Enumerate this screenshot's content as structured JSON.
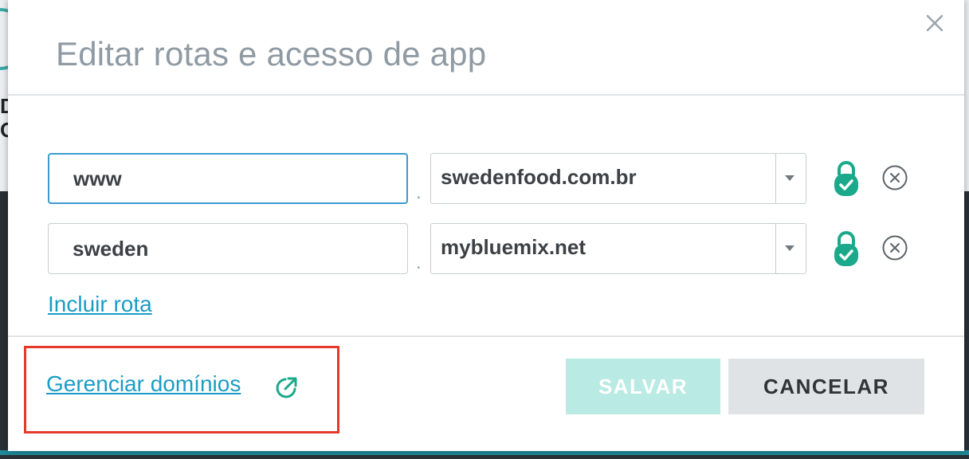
{
  "dialog": {
    "title": "Editar rotas e acesso de app",
    "close_icon": "close-icon"
  },
  "routes": [
    {
      "host": "www",
      "domain": "swedenfood.com.br",
      "separator": ".",
      "secure_icon": "lock-check-icon",
      "remove_icon": "remove-circle-icon",
      "focused": true
    },
    {
      "host": "sweden",
      "domain": "mybluemix.net",
      "separator": ".",
      "secure_icon": "lock-check-icon",
      "remove_icon": "remove-circle-icon",
      "focused": false
    }
  ],
  "actions": {
    "add_route": "Incluir rota",
    "manage_domains": "Gerenciar domínios",
    "manage_domains_icon": "external-link-icon",
    "save": "SALVAR",
    "cancel": "CANCELAR"
  },
  "colors": {
    "accent": "#1a9cc4",
    "secure": "#1aa98a",
    "save_disabled": "#b9eae4",
    "highlight_box": "#e53a2b"
  }
}
